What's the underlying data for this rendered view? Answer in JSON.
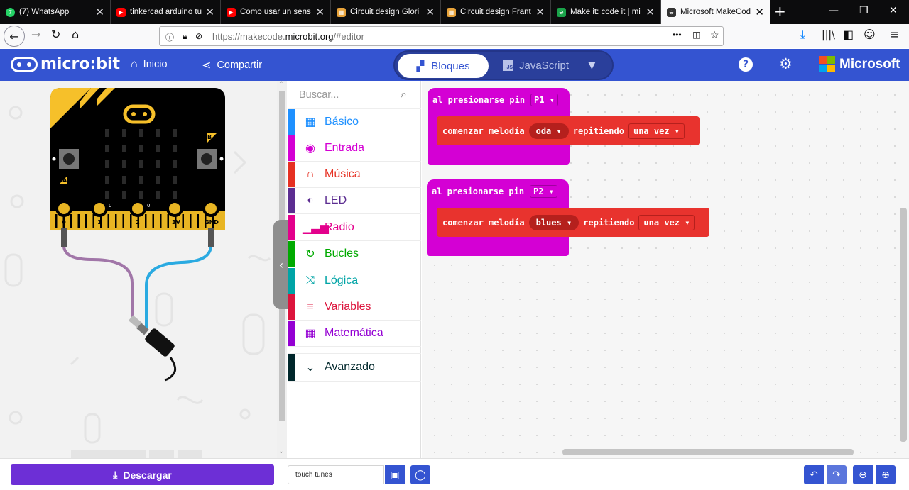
{
  "browser": {
    "tabs": [
      {
        "title": "(7) WhatsApp",
        "fav_color": "#25d366",
        "fav_text": "7"
      },
      {
        "title": "tinkercad arduino tu",
        "fav_color": "#ff0000",
        "fav_text": "▶"
      },
      {
        "title": "Como usar un sens",
        "fav_color": "#ff0000",
        "fav_text": "▶"
      },
      {
        "title": "Circuit design Glori",
        "fav_color": "#e8a33a",
        "fav_text": "▦"
      },
      {
        "title": "Circuit design Frant",
        "fav_color": "#e8a33a",
        "fav_text": "▦"
      },
      {
        "title": "Make it: code it | mi",
        "fav_color": "#1aa34a",
        "fav_text": "⊖"
      },
      {
        "title": "Microsoft MakeCod",
        "fav_color": "#333333",
        "fav_text": "⊖"
      }
    ],
    "url_prefix": "https://makecode.",
    "url_domain": "microbit.org",
    "url_suffix": "/#editor"
  },
  "header": {
    "logo_text": "micro:bit",
    "home_label": "Inicio",
    "share_label": "Compartir",
    "blocks_label": "Bloques",
    "js_label": "JavaScript",
    "js_badge": "JS",
    "ms_label": "Microsoft"
  },
  "simulator": {
    "button_a": "A",
    "button_b": "B",
    "pins": [
      "0",
      "1",
      "2",
      "3V",
      "GND"
    ]
  },
  "toolbox": {
    "search_placeholder": "Buscar...",
    "categories": [
      {
        "label": "Básico",
        "color": "#1e90ff",
        "icon": "grid-icon"
      },
      {
        "label": "Entrada",
        "color": "#d400d4",
        "icon": "target-icon"
      },
      {
        "label": "Música",
        "color": "#e63022",
        "icon": "headphones-icon"
      },
      {
        "label": "LED",
        "color": "#5c2d91",
        "icon": "toggle-icon"
      },
      {
        "label": "Radio",
        "color": "#e3008c",
        "icon": "signal-icon"
      },
      {
        "label": "Bucles",
        "color": "#00aa00",
        "icon": "loop-icon"
      },
      {
        "label": "Lógica",
        "color": "#00a4a6",
        "icon": "shuffle-icon"
      },
      {
        "label": "Variables",
        "color": "#dc143c",
        "icon": "list-icon"
      },
      {
        "label": "Matemática",
        "color": "#9400d3",
        "icon": "calculator-icon"
      },
      {
        "label": "Avanzado",
        "color": "#00272b",
        "icon": "chevron-down-icon"
      }
    ]
  },
  "workspace": {
    "blocks": [
      {
        "event_label": "al presionarse pin",
        "pin": "P1",
        "play_label": "comenzar melodía",
        "melody": "oda",
        "repeat_label": "repitiendo",
        "repeat_value": "una vez"
      },
      {
        "event_label": "al presionarse pin",
        "pin": "P2",
        "play_label": "comenzar melodía",
        "melody": "blues",
        "repeat_label": "repitiendo",
        "repeat_value": "una vez"
      }
    ]
  },
  "footer": {
    "download_label": "Descargar",
    "project_name": "touch tunes"
  }
}
